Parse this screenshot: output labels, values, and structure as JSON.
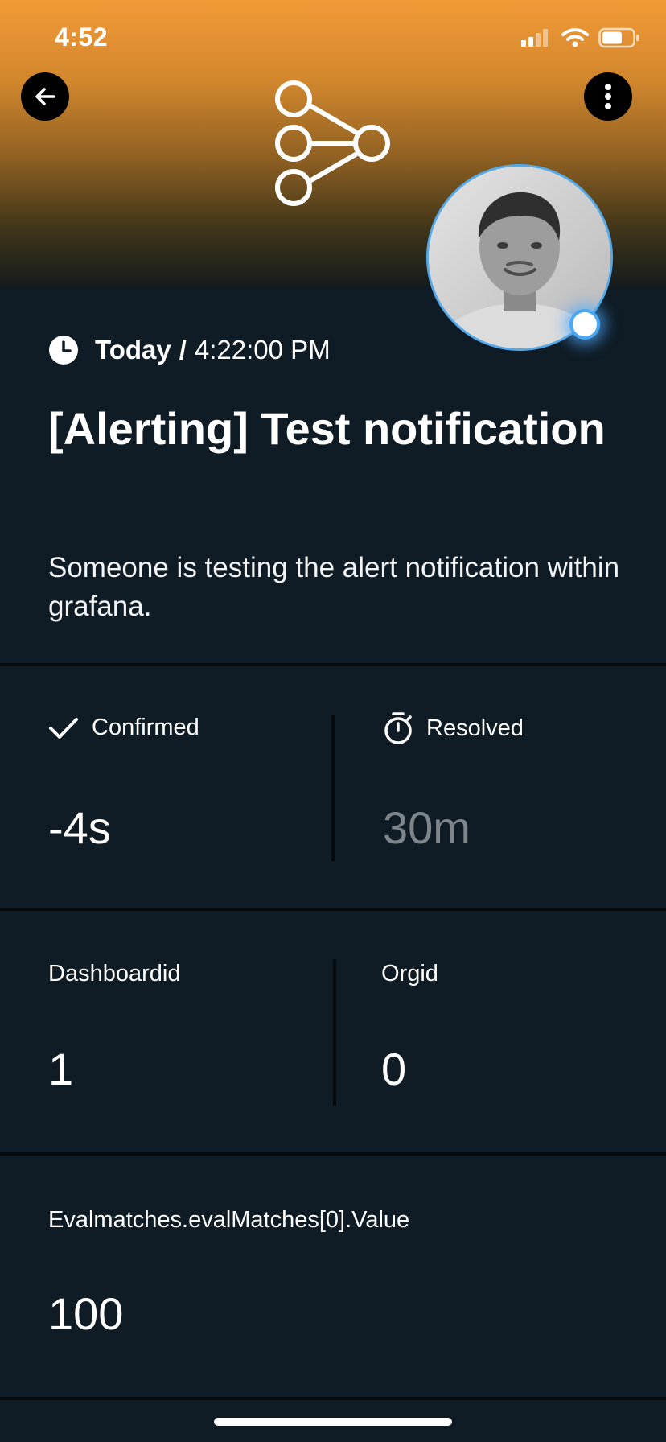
{
  "status_bar": {
    "time": "4:52",
    "icons": [
      "cellular-signal-icon",
      "wifi-icon",
      "battery-icon"
    ]
  },
  "header": {
    "back_icon": "arrow-left-icon",
    "menu_icon": "more-vertical-icon",
    "logo_icon": "network-graph-icon",
    "colors": {
      "gradient_top": "#f29a38",
      "gradient_bottom": "#141a1c",
      "presence": "#4aa8f0"
    }
  },
  "alert": {
    "day": "Today",
    "separator": "/",
    "time": "4:22:00 PM",
    "title": "[Alerting] Test notification",
    "description": "Someone is testing the alert notification within grafana."
  },
  "stats": {
    "confirmed_label": "Confirmed",
    "confirmed_value": "-4s",
    "resolved_label": "Resolved",
    "resolved_value": "30m"
  },
  "fields": [
    {
      "label": "Dashboardid",
      "value": "1"
    },
    {
      "label": "Orgid",
      "value": "0"
    },
    {
      "label": "Evalmatches.evalMatches[0].Value",
      "value": "100"
    }
  ],
  "colors": {
    "background": "#0f1c25",
    "divider": "#050a0e",
    "muted_value": "#7e868b"
  }
}
